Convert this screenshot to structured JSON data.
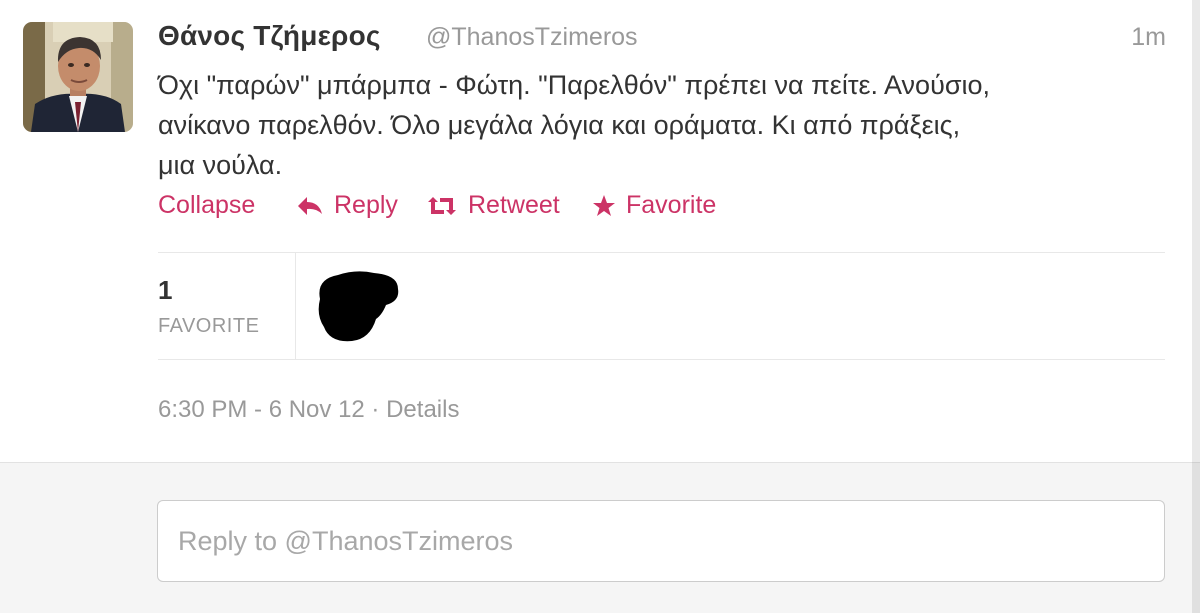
{
  "tweet": {
    "fullname": "Θάνος Τζήμερος",
    "username": "@ThanosTzimeros",
    "time": "1m",
    "text_lines": [
      "Όχι \"παρών\" μπάρμπα - Φώτη. \"Παρελθόν\" πρέπει να πείτε. Ανούσιο,",
      "ανίκανο παρελθόν. Όλο μεγάλα λόγια και οράματα. Κι από πράξεις,",
      "μια νούλα."
    ],
    "actions": {
      "collapse": "Collapse",
      "reply": "Reply",
      "retweet": "Retweet",
      "favorite": "Favorite"
    },
    "stats": {
      "favorites_count": "1",
      "favorites_label": "FAVORITE"
    },
    "meta": {
      "timestamp": "6:30 PM - 6 Nov 12",
      "separator": " · ",
      "details": "Details"
    }
  },
  "reply": {
    "placeholder": "Reply to @ThanosTzimeros"
  },
  "colors": {
    "link": "#cc3366",
    "secondary_text": "#999999",
    "primary_text": "#333333"
  },
  "icons": [
    "reply-arrow-icon",
    "retweet-icon",
    "star-icon"
  ]
}
